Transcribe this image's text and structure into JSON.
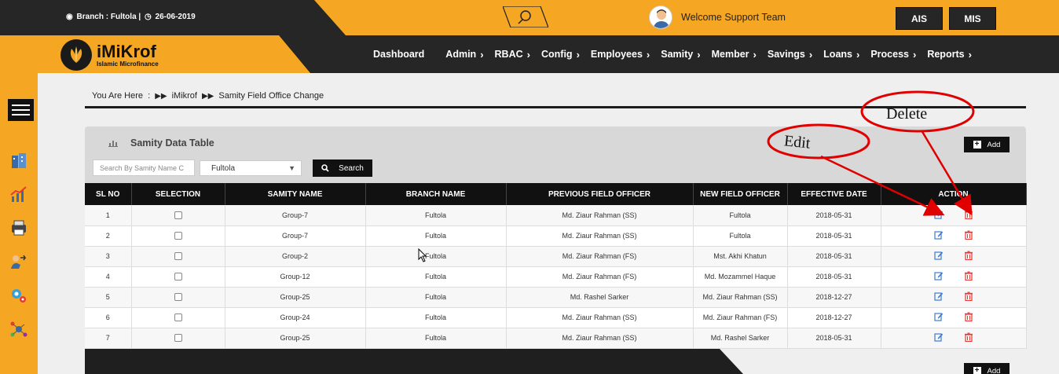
{
  "topbar": {
    "branch_label": "Branch : Fultola |",
    "date": "26-06-2019",
    "welcome": "Welcome Support Team",
    "btn_ais": "AIS",
    "btn_mis": "MIS",
    "icons": [
      "globe-icon",
      "clock-icon",
      "search-icon",
      "user-avatar"
    ]
  },
  "logo": {
    "name": "iMiKrof",
    "subtitle": "Islamic Microfinance"
  },
  "menu": [
    {
      "label": "Dashboard",
      "chevron": false
    },
    {
      "label": "Admin",
      "chevron": true
    },
    {
      "label": "RBAC",
      "chevron": true
    },
    {
      "label": "Config",
      "chevron": true
    },
    {
      "label": "Employees",
      "chevron": true
    },
    {
      "label": "Samity",
      "chevron": true
    },
    {
      "label": "Member",
      "chevron": true
    },
    {
      "label": "Savings",
      "chevron": true
    },
    {
      "label": "Loans",
      "chevron": true
    },
    {
      "label": "Process",
      "chevron": true
    },
    {
      "label": "Reports",
      "chevron": true
    }
  ],
  "breadcrumb": {
    "prefix": "You Are Here  :",
    "items": [
      "iMikrof",
      "Samity Field Office Change"
    ]
  },
  "panel": {
    "title": "Samity Data Table",
    "add_label": "Add",
    "search_placeholder": "Search By Samity Name C",
    "branch_select": "Fultola",
    "search_btn": "Search"
  },
  "table": {
    "headers": [
      "SL NO",
      "SELECTION",
      "SAMITY NAME",
      "BRANCH NAME",
      "PREVIOUS FIELD OFFICER",
      "NEW FIELD OFFICER",
      "EFFECTIVE DATE",
      "ACTION"
    ],
    "rows": [
      {
        "sl": "1",
        "samity": "Group-7",
        "branch": "Fultola",
        "prev": "Md. Ziaur Rahman (SS)",
        "new": "Fultola",
        "date": "2018-05-31"
      },
      {
        "sl": "2",
        "samity": "Group-7",
        "branch": "Fultola",
        "prev": "Md. Ziaur Rahman (SS)",
        "new": "Fultola",
        "date": "2018-05-31"
      },
      {
        "sl": "3",
        "samity": "Group-2",
        "branch": "Fultola",
        "prev": "Md. Ziaur Rahman (FS)",
        "new": "Mst. Akhi Khatun",
        "date": "2018-05-31"
      },
      {
        "sl": "4",
        "samity": "Group-12",
        "branch": "Fultola",
        "prev": "Md. Ziaur Rahman (FS)",
        "new": "Md. Mozammel Haque",
        "date": "2018-05-31"
      },
      {
        "sl": "5",
        "samity": "Group-25",
        "branch": "Fultola",
        "prev": "Md. Rashel Sarker",
        "new": "Md. Ziaur Rahman (SS)",
        "date": "2018-12-27"
      },
      {
        "sl": "6",
        "samity": "Group-24",
        "branch": "Fultola",
        "prev": "Md. Ziaur Rahman (SS)",
        "new": "Md. Ziaur Rahman (FS)",
        "date": "2018-12-27"
      },
      {
        "sl": "7",
        "samity": "Group-25",
        "branch": "Fultola",
        "prev": "Md. Ziaur Rahman (SS)",
        "new": "Md. Rashel Sarker",
        "date": "2018-05-31"
      }
    ]
  },
  "annotations": {
    "edit": "Edit",
    "delete": "Delete"
  },
  "colors": {
    "accent": "#f5a623",
    "dark": "#262626",
    "edit": "#3a7bd5",
    "delete": "#e53935",
    "annotation": "#e00000"
  }
}
